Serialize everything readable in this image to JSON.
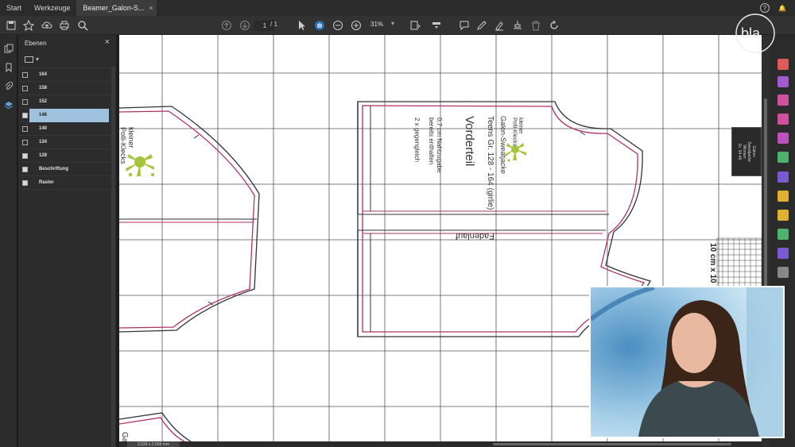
{
  "tabs": [
    {
      "label": "Start"
    },
    {
      "label": "Werkzeuge"
    },
    {
      "label": "Beamer_Galon-S...",
      "close": "×"
    }
  ],
  "toolbar": {
    "page_current": "1",
    "page_total": "/ 1",
    "zoom": "31%"
  },
  "layers_panel": {
    "title": "Ebenen",
    "close": "×",
    "items": [
      {
        "label": "164",
        "checked": false
      },
      {
        "label": "158",
        "checked": false
      },
      {
        "label": "152",
        "checked": false
      },
      {
        "label": "146",
        "checked": true,
        "selected": true
      },
      {
        "label": "140",
        "checked": false
      },
      {
        "label": "134",
        "checked": false
      },
      {
        "label": "128",
        "checked": true
      },
      {
        "label": "Beschriftung",
        "checked": true
      },
      {
        "label": "Raster",
        "checked": true
      }
    ]
  },
  "pattern": {
    "logo_left": "kleiner\nPolli-Klecks",
    "logo_right": "kleiner\nPolli-Klecks",
    "product": "Galon-Sweatjacke",
    "sizes": "Teens Gr. 128 - 164 (girlie)",
    "piece": "Vorderteil",
    "seam": "0,7 cm Nahtzugabe",
    "included": "bereits enthalten",
    "count": "2 x gegengleich",
    "grain": "Fadenlauf",
    "scale": "10 cm x 10",
    "bottom_text": "Gal"
  },
  "tooltip": {
    "text": "Galon-\nSweatjacke\nWomen\nGr. 34-46"
  },
  "status": {
    "dimensions": "3.536 x 2.658 mm"
  },
  "logo": {
    "text": "bla"
  },
  "colors": {
    "accent_selected": "#9fc3de",
    "pattern_pink": "#b0306a",
    "pattern_dark": "#333333",
    "logo_green": "#a6c43a"
  }
}
